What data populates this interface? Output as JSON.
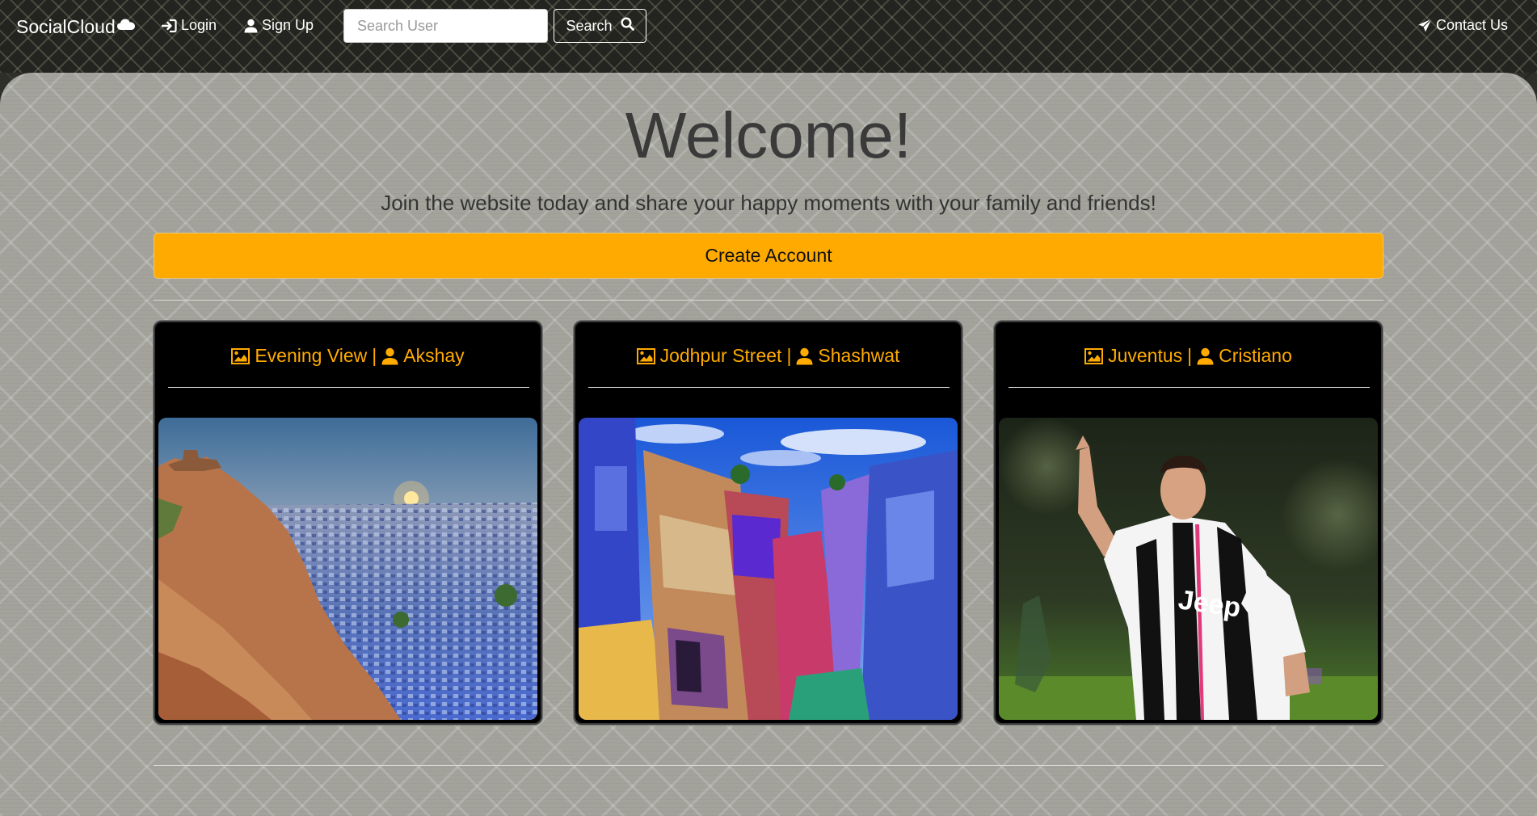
{
  "navbar": {
    "brand": "SocialCloud",
    "login_label": "Login",
    "signup_label": "Sign Up",
    "search_placeholder": "Search User",
    "search_button_label": "Search",
    "contact_label": "Contact Us"
  },
  "hero": {
    "title": "Welcome!",
    "subtitle": "Join the website today and share your happy moments with your family and friends!",
    "create_account_label": "Create Account"
  },
  "posts": [
    {
      "title": "Evening View",
      "separator": "|",
      "author": "Akshay",
      "image": "jodhpur-sunset-cityscape"
    },
    {
      "title": "Jodhpur Street",
      "separator": "|",
      "author": "Shashwat",
      "image": "blue-city-street"
    },
    {
      "title": "Juventus",
      "separator": "|",
      "author": "Cristiano",
      "image": "footballer-celebrating"
    }
  ],
  "colors": {
    "accent": "#ffaa00",
    "card_background": "#000000",
    "title_text": "#3a3a3a"
  },
  "icons": {
    "brand": "cloud-icon",
    "login": "login-icon",
    "signup": "user-icon",
    "search": "search-icon",
    "contact": "paper-plane-icon",
    "post_image": "image-icon",
    "post_author": "user-icon"
  }
}
